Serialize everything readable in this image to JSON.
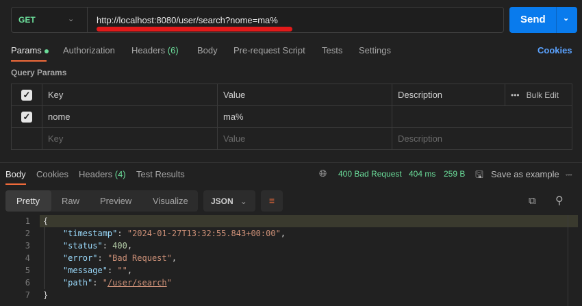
{
  "request": {
    "method": "GET",
    "url": "http://localhost:8080/user/search?nome=ma%",
    "send_label": "Send"
  },
  "tabs": {
    "params": "Params",
    "authorization": "Authorization",
    "headers": "Headers",
    "headers_count": "(6)",
    "body": "Body",
    "pre_request": "Pre-request Script",
    "tests": "Tests",
    "settings": "Settings",
    "cookies": "Cookies"
  },
  "query_params": {
    "title": "Query Params",
    "headers": {
      "key": "Key",
      "value": "Value",
      "description": "Description",
      "bulk_edit": "Bulk Edit"
    },
    "rows": [
      {
        "key": "nome",
        "value": "ma%",
        "description": "",
        "checked": true
      }
    ],
    "placeholders": {
      "key": "Key",
      "value": "Value",
      "description": "Description"
    }
  },
  "response": {
    "tabs": {
      "body": "Body",
      "cookies": "Cookies",
      "headers": "Headers",
      "headers_count": "(4)",
      "test_results": "Test Results"
    },
    "status": "400 Bad Request",
    "time": "404 ms",
    "size": "259 B",
    "save_example": "Save as example",
    "views": {
      "pretty": "Pretty",
      "raw": "Raw",
      "preview": "Preview",
      "visualize": "Visualize"
    },
    "format": "JSON",
    "lines": [
      "1",
      "2",
      "3",
      "4",
      "5",
      "6",
      "7"
    ],
    "body": {
      "timestamp_key": "\"timestamp\"",
      "timestamp": "\"2024-01-27T13:32:55.843+00:00\"",
      "status_key": "\"status\"",
      "status": "400",
      "error_key": "\"error\"",
      "error": "\"Bad Request\"",
      "message_key": "\"message\"",
      "message": "\"\"",
      "path_key": "\"path\"",
      "path": "/user/search"
    }
  },
  "colors": {
    "accent": "#097bed",
    "green": "#6bdd9a",
    "orange": "#f26b3a"
  }
}
